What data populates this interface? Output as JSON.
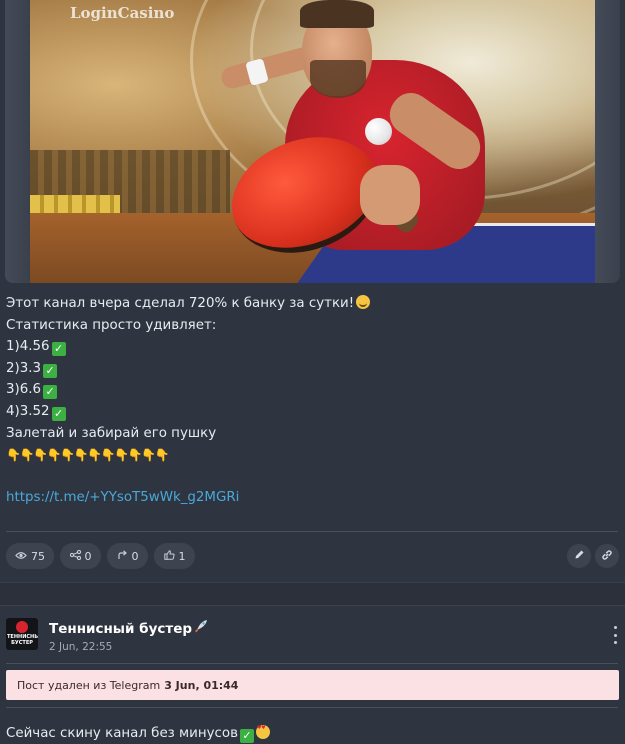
{
  "post": {
    "image_watermark": "LoginCasino",
    "lines": [
      "Этот канал вчера сделал 720% к банку за сутки!",
      "Статистика просто удивляет:",
      "1)4.56",
      "2)3.3",
      "3)6.6",
      "4)3.52",
      "Залетай и забирай его пушку"
    ],
    "link": "https://t.me/+YYsoT5wWk_g2MGRi",
    "emoji_check": "✓",
    "emoji_pointing_down": "👇",
    "stats": {
      "views": "75",
      "shares": "0",
      "forwards": "0",
      "likes": "1"
    }
  },
  "next_post": {
    "channel_name": "Теннисный бустер",
    "avatar_text": "ТЕННИСНЫЙ БУСТЕР",
    "date": "2 Jun, 22:55",
    "deleted_notice": "Пост удален из Telegram",
    "deleted_date": "3 Jun, 01:44",
    "message": "Сейчас скину канал без минусов"
  },
  "colors": {
    "background": "#2f3540",
    "link": "#4aa8d8",
    "deleted_bg": "#fbe1e3",
    "check_green": "#3cb043"
  }
}
